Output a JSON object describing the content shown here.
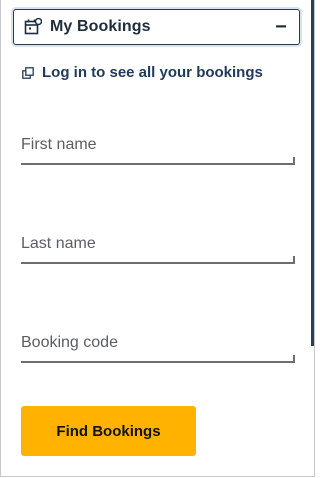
{
  "widget": {
    "title": "My Bookings",
    "collapse_symbol": "−",
    "icon": "calendar-icon",
    "toggle_icon": "minus-icon"
  },
  "login": {
    "icon": "external-link-icon",
    "text": "Log in to see all your bookings"
  },
  "form": {
    "first_name_placeholder": "First name",
    "last_name_placeholder": "Last name",
    "booking_code_placeholder": "Booking code",
    "submit_label": "Find Bookings"
  },
  "colors": {
    "accent_button": "#ffb300",
    "text_dark": "#1f2d3d",
    "link": "#1f3a5a",
    "underline": "#6b6f75"
  }
}
